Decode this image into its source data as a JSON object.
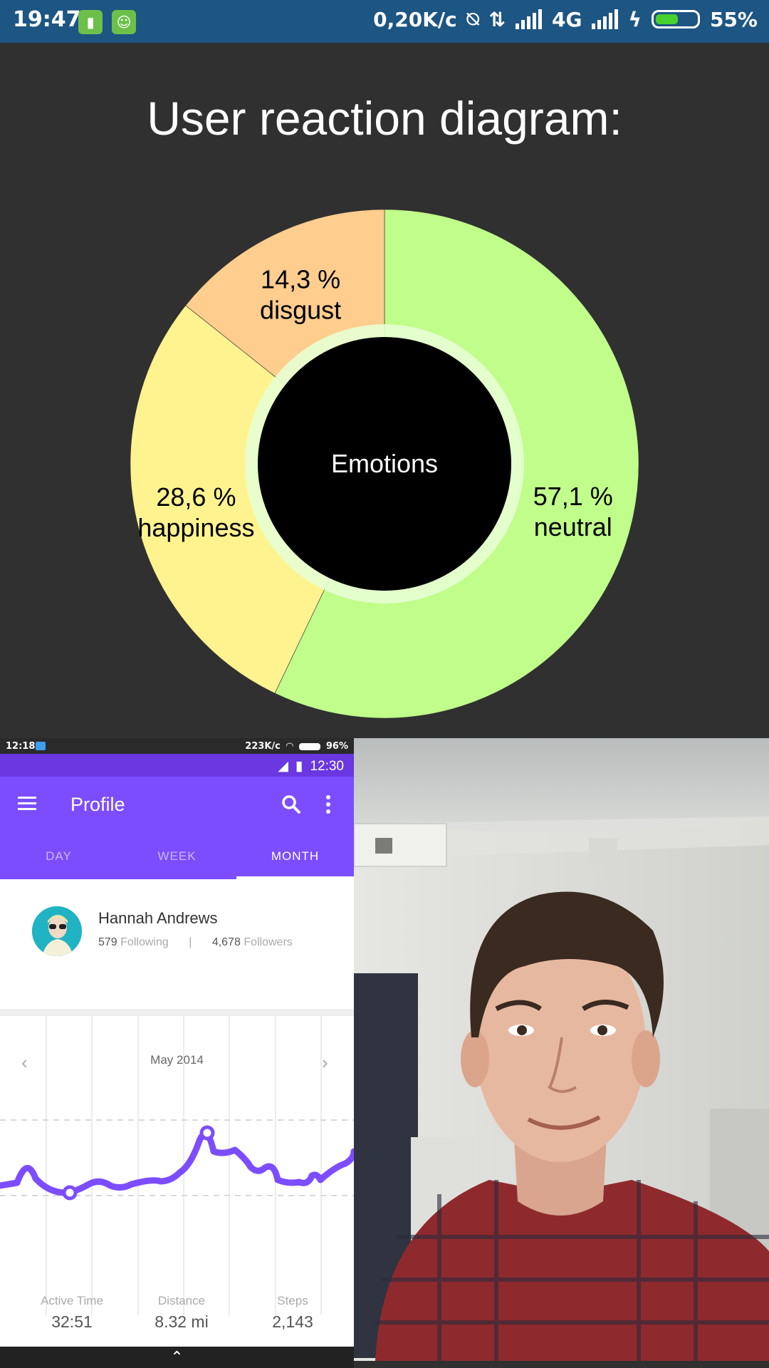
{
  "status_bar": {
    "time": "19:47",
    "net_speed": "0,20K/c",
    "network": "4G",
    "battery_percent": "55%",
    "battery_level": 0.55,
    "icons": [
      "battery-app-icon",
      "android-app-icon",
      "mute-vibrate-icon",
      "data-transfer-icon",
      "signal-icon",
      "signal-icon",
      "charging-icon",
      "battery-icon"
    ]
  },
  "chart_title": "User reaction diagram:",
  "chart_data": {
    "type": "pie",
    "center_label": "Emotions",
    "slices": [
      {
        "label": "neutral",
        "value": 57.1,
        "value_label": "57,1 %",
        "color": "#c0fd8a"
      },
      {
        "label": "happiness",
        "value": 28.6,
        "value_label": "28,6 %",
        "color": "#fff38f"
      },
      {
        "label": "disgust",
        "value": 14.3,
        "value_label": "14,3 %",
        "color": "#ffcd8e"
      }
    ]
  },
  "preview": {
    "status": {
      "time": "12:18",
      "speed": "223K/c",
      "battery": "96%"
    },
    "system_time": "12:30",
    "toolbar_title": "Profile",
    "tabs": [
      {
        "label": "DAY"
      },
      {
        "label": "WEEK"
      },
      {
        "label": "MONTH",
        "active": true
      }
    ],
    "profile": {
      "name": "Hannah Andrews",
      "following_count": "579",
      "following_label": "Following",
      "divider": "|",
      "followers_count": "4,678",
      "followers_label": "Followers"
    },
    "month_label": "May 2014",
    "stats": [
      {
        "label": "Active Time",
        "value": "32:51"
      },
      {
        "label": "Distance",
        "value": "8.32 mi"
      },
      {
        "label": "Steps",
        "value": "2,143"
      }
    ]
  },
  "camera": {
    "subject": "camera-preview"
  }
}
